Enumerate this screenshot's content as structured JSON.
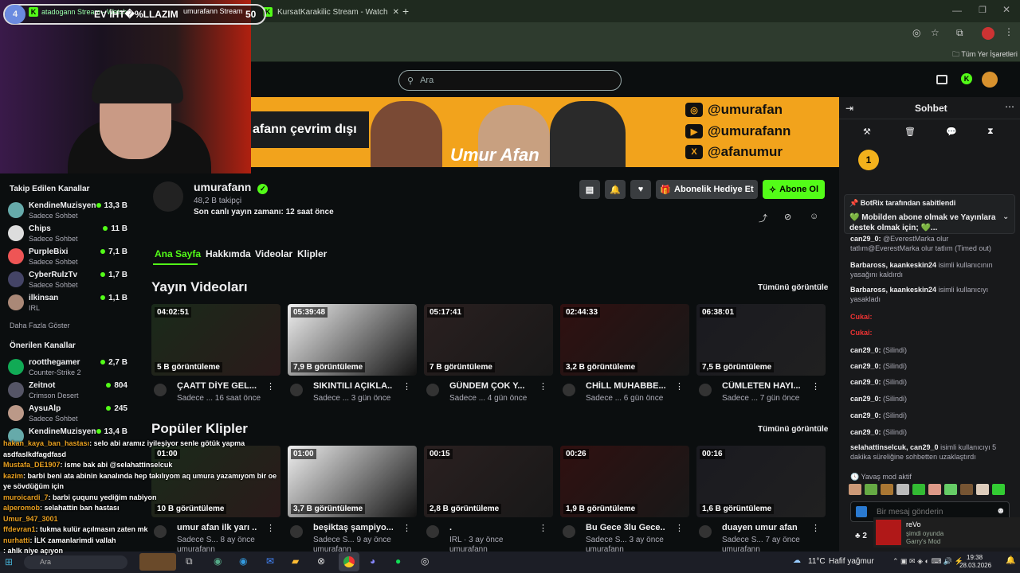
{
  "browser": {
    "tabs": [
      {
        "label": "atadogann Stream - Watch"
      },
      {
        "label": "umurafann Stream - Watch Li"
      },
      {
        "label": "KursatKarakilic Stream - Watch"
      }
    ],
    "bookmarks_label": "Tüm Yer İşaretleri"
  },
  "overlay": {
    "counter": "4",
    "text": "EV İHT�%LLAZIM",
    "goal": "50"
  },
  "search": {
    "placeholder": "Ara"
  },
  "banner": {
    "offline_text": "afann çevrim dışı",
    "social": [
      "@umurafan",
      "@umurafann",
      "@afanumur"
    ]
  },
  "sidebar": {
    "followed_title": "Takip Edilen Kanallar",
    "followed": [
      {
        "name": "KendineMuzisyen",
        "cat": "Sadece Sohbet",
        "viewers": "13,3 B",
        "color": "#6aa"
      },
      {
        "name": "Chips",
        "cat": "Sadece Sohbet",
        "viewers": "11 B",
        "color": "#ddd"
      },
      {
        "name": "PurpleBixi",
        "cat": "Sadece Sohbet",
        "viewers": "7,1 B",
        "color": "#e55"
      },
      {
        "name": "CyberRulzTv",
        "cat": "Sadece Sohbet",
        "viewers": "1,7 B",
        "color": "#446"
      },
      {
        "name": "ilkinsan",
        "cat": "IRL",
        "viewers": "1,1 B",
        "color": "#a87"
      }
    ],
    "more": "Daha Fazla Göster",
    "recommended_title": "Önerilen Kanallar",
    "recommended": [
      {
        "name": "rootthegamer",
        "cat": "Counter-Strike 2",
        "viewers": "2,7 B",
        "color": "#1a5"
      },
      {
        "name": "Zeitnot",
        "cat": "Crimson Desert",
        "viewers": "804",
        "color": "#556"
      },
      {
        "name": "AysuAlp",
        "cat": "Sadece Sohbet",
        "viewers": "245",
        "color": "#b98"
      },
      {
        "name": "KendineMuzisyen",
        "cat": "",
        "viewers": "13,4 B",
        "color": "#6aa"
      }
    ]
  },
  "channel": {
    "name": "umurafann",
    "followers": "48,2 B takipçi",
    "last_live": "Son canlı yayın zamanı: 12 saat önce",
    "gift_btn": "Abonelik Hediye Et",
    "sub_btn": "Abone Ol",
    "tabs": [
      "Ana Sayfa",
      "Hakkımda",
      "Videolar",
      "Klipler"
    ]
  },
  "videos": {
    "title": "Yayın Videoları",
    "see_all": "Tümünü görüntüle",
    "items": [
      {
        "dur": "04:02:51",
        "views": "5 B görüntüleme",
        "title": "ÇAATT DİYE GEL...",
        "sub": "Sadece ... 16 saat önce"
      },
      {
        "dur": "05:39:48",
        "views": "7,9 B görüntüleme",
        "title": "SIKINTILI AÇIKLA...",
        "sub": "Sadece ... 3 gün önce"
      },
      {
        "dur": "05:17:41",
        "views": "7 B görüntüleme",
        "title": "GÜNDEM ÇOK Y...",
        "sub": "Sadece ... 4 gün önce"
      },
      {
        "dur": "02:44:33",
        "views": "3,2 B görüntüleme",
        "title": "CHİLL MUHABBE...",
        "sub": "Sadece ... 6 gün önce"
      },
      {
        "dur": "06:38:01",
        "views": "7,5 B görüntüleme",
        "title": "CÜMLETEN HAYI...",
        "sub": "Sadece ... 7 gün önce"
      }
    ]
  },
  "clips": {
    "title": "Popüler Klipler",
    "see_all": "Tümünü görüntüle",
    "items": [
      {
        "dur": "01:00",
        "views": "10 B görüntüleme",
        "title": "umur afan ilk yarı ...",
        "sub": "Sadece S... 8 ay önce",
        "author": "umurafann"
      },
      {
        "dur": "01:00",
        "views": "3,7 B görüntüleme",
        "title": "beşiktaş şampiyo...",
        "sub": "Sadece S... 9 ay önce",
        "author": "umurafann"
      },
      {
        "dur": "00:15",
        "views": "2,8 B görüntüleme",
        "title": ".",
        "sub": "IRL · 3 ay önce",
        "author": "umurafann"
      },
      {
        "dur": "00:26",
        "views": "1,9 B görüntüleme",
        "title": "Bu Gece 3lu Gece...",
        "sub": "Sadece S... 3 ay önce",
        "author": "umurafann"
      },
      {
        "dur": "00:16",
        "views": "1,6 B görüntüleme",
        "title": "duayen umur afan",
        "sub": "Sadece S... 7 ay önce",
        "author": "umurafann"
      }
    ]
  },
  "chat": {
    "title": "Sohbet",
    "pinned_by": "BotRix tarafından sabitlendi",
    "pinned_msg": "💚 Mobilden abone olmak ve Yayınlara destek olmak için; 💚...",
    "msgs": [
      {
        "user": "can29_0:",
        "text": "@EverestMarka olur tatlım@EverestMarka olur tatlım (Timed out)"
      },
      {
        "user": "Barbaross, kaankeskin24",
        "text": "isimli kullanıcının yasağını kaldırdı"
      },
      {
        "user": "Barbaross, kaankeskin24",
        "text": "isimli kullanıcıyı yasakladı"
      },
      {
        "user": "Cukai:",
        "text": ""
      },
      {
        "user": "Cukai:",
        "text": ""
      },
      {
        "user": "can29_0:",
        "text": "(Silindi)"
      },
      {
        "user": "can29_0:",
        "text": "(Silindi)"
      },
      {
        "user": "can29_0:",
        "text": "(Silindi)"
      },
      {
        "user": "can29_0:",
        "text": "(Silindi)"
      },
      {
        "user": "can29_0:",
        "text": "(Silindi)"
      },
      {
        "user": "can29_0:",
        "text": "(Silindi)"
      },
      {
        "user": "selahattinselcuk, can29_0",
        "text": "isimli kullanıcıyı 5 dakika süreliğine sohbetten uzaklaştırdı"
      }
    ],
    "slow_mode": "Yavaş mod aktif",
    "placeholder": "Bir mesaj gönderin",
    "viewer_count": "2",
    "now_playing_name": "reVo",
    "now_playing_status": "şimdi oyunda",
    "now_playing_game": "Garry's Mod"
  },
  "overlay_chat": [
    {
      "u": "hakan_kaya_ban_hastası",
      "t": ": selo abi aramız iyileşiyor senle götük yapma"
    },
    {
      "u": "",
      "t": "asdfaslkdfagdfasd"
    },
    {
      "u": "Mustafa_DE1907",
      "t": ": isme bak abi @selahattinselcuk"
    },
    {
      "u": "kazim",
      "t": ": barbi beni ata abinin kanalında hep takılıyom aq umura yazamıyom bir oe"
    },
    {
      "u": "",
      "t": "ye sövdüğüm için"
    },
    {
      "u": "muroicardi_7",
      "t": ": barbi çuqunu yediğim nabiyon"
    },
    {
      "u": "alperomob",
      "t": ": selahattin ban hastası"
    },
    {
      "u": "Umur_947_3001",
      "t": ""
    },
    {
      "u": "ffdevran1",
      "t": ": tukma kulür açılmasın zaten mk"
    },
    {
      "u": "nurhatti",
      "t": ": İLK zamanlarimdi vallah"
    },
    {
      "u": "",
      "t": ": ahlk niye açıyon"
    }
  ],
  "taskbar": {
    "weather_temp": "11°C",
    "weather_text": "Hafif yağmur",
    "time": "19:38",
    "date": "28.03.2026",
    "search": "Ara"
  }
}
